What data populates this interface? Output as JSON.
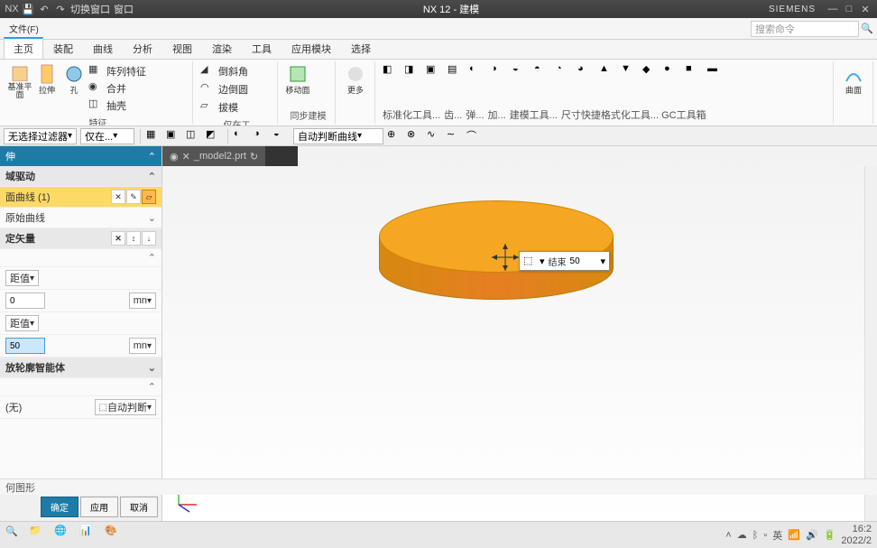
{
  "title": "NX 12 - 建模",
  "brand": "SIEMENS",
  "topmenu": {
    "switch_window": "切换窗口",
    "window": "窗口"
  },
  "search_placeholder": "搜索命令",
  "tabs": [
    "主页",
    "装配",
    "曲线",
    "分析",
    "视图",
    "渲染",
    "工具",
    "应用模块",
    "选择"
  ],
  "ribbon": {
    "g1": {
      "datum": "基准平面",
      "extrude": "拉伸",
      "hole": "孔"
    },
    "g1_side": {
      "pattern": "阵列特征",
      "union": "合并",
      "shell": "抽壳"
    },
    "g1_label": "特征",
    "g2": {
      "chamfer": "倒斜角",
      "edge_blend": "边倒圆",
      "draft": "拔模"
    },
    "g2_side": "仅在工",
    "g3": {
      "move": "移动面",
      "label": "同步建模"
    },
    "g4": {
      "more": "更多"
    },
    "glabels": [
      "标准化工具...",
      "齿...",
      "弹...",
      "加...",
      "建模工具...",
      "尺寸快捷格式化工具... GC工具箱"
    ],
    "surface": "曲面"
  },
  "selbar": {
    "filter": "无选择过滤器",
    "layer": "仅在...",
    "auto": "自动判断曲线"
  },
  "dialog": {
    "title": "伸",
    "subtitle": "域驱动",
    "curve": "面曲线 (1)",
    "original_curve": "原始曲线",
    "vector": "定矢量",
    "distance": "距值",
    "start_val": "0",
    "end_val": "50",
    "unit": "mn",
    "bool_section": "放轮廓智能体",
    "bool_val": "(无)",
    "auto": "自动判断",
    "ok": "确定",
    "apply": "应用",
    "cancel": "取消"
  },
  "doc_tab": "_model2.prt",
  "status": "何图形",
  "float": {
    "label": "结束",
    "value": "50"
  },
  "taskbar": {
    "ime": "英",
    "time": "16:2",
    "date": "2022/2"
  }
}
